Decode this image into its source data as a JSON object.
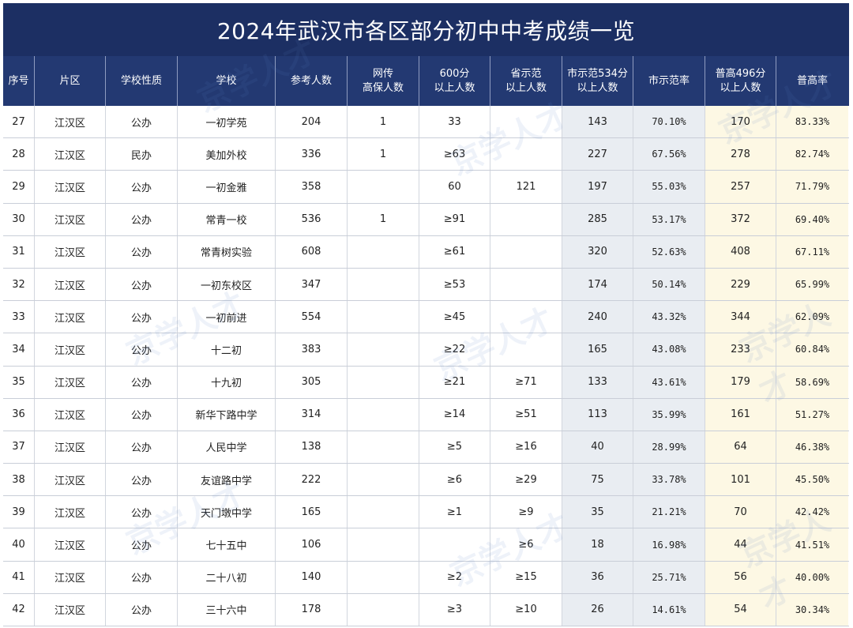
{
  "title": "2024年武汉市各区部分初中中考成绩一览",
  "columns": [
    "序号",
    "片区",
    "学校性质",
    "学校",
    "参考人数",
    "网传\n高保人数",
    "600分\n以上人数",
    "省示范\n以上人数",
    "市示范534分\n以上人数",
    "市示范率",
    "普高496分\n以上人数",
    "普高率"
  ],
  "rows": [
    [
      "27",
      "江汉区",
      "公办",
      "一初学苑",
      "204",
      "1",
      "33",
      "",
      "143",
      "70.10%",
      "170",
      "83.33%"
    ],
    [
      "28",
      "江汉区",
      "民办",
      "美加外校",
      "336",
      "1",
      "≥63",
      "",
      "227",
      "67.56%",
      "278",
      "82.74%"
    ],
    [
      "29",
      "江汉区",
      "公办",
      "一初金雅",
      "358",
      "",
      "60",
      "121",
      "197",
      "55.03%",
      "257",
      "71.79%"
    ],
    [
      "30",
      "江汉区",
      "公办",
      "常青一校",
      "536",
      "1",
      "≥91",
      "",
      "285",
      "53.17%",
      "372",
      "69.40%"
    ],
    [
      "31",
      "江汉区",
      "公办",
      "常青树实验",
      "608",
      "",
      "≥61",
      "",
      "320",
      "52.63%",
      "408",
      "67.11%"
    ],
    [
      "32",
      "江汉区",
      "公办",
      "一初东校区",
      "347",
      "",
      "≥53",
      "",
      "174",
      "50.14%",
      "229",
      "65.99%"
    ],
    [
      "33",
      "江汉区",
      "公办",
      "一初前进",
      "554",
      "",
      "≥45",
      "",
      "240",
      "43.32%",
      "344",
      "62.09%"
    ],
    [
      "34",
      "江汉区",
      "公办",
      "十二初",
      "383",
      "",
      "≥22",
      "",
      "165",
      "43.08%",
      "233",
      "60.84%"
    ],
    [
      "35",
      "江汉区",
      "公办",
      "十九初",
      "305",
      "",
      "≥21",
      "≥71",
      "133",
      "43.61%",
      "179",
      "58.69%"
    ],
    [
      "36",
      "江汉区",
      "公办",
      "新华下路中学",
      "314",
      "",
      "≥14",
      "≥51",
      "113",
      "35.99%",
      "161",
      "51.27%"
    ],
    [
      "37",
      "江汉区",
      "公办",
      "人民中学",
      "138",
      "",
      "≥5",
      "≥16",
      "40",
      "28.99%",
      "64",
      "46.38%"
    ],
    [
      "38",
      "江汉区",
      "公办",
      "友谊路中学",
      "222",
      "",
      "≥6",
      "≥29",
      "75",
      "33.78%",
      "101",
      "45.50%"
    ],
    [
      "39",
      "江汉区",
      "公办",
      "天门墩中学",
      "165",
      "",
      "≥1",
      "≥9",
      "35",
      "21.21%",
      "70",
      "42.42%"
    ],
    [
      "40",
      "江汉区",
      "公办",
      "七十五中",
      "106",
      "",
      "",
      "≥6",
      "18",
      "16.98%",
      "44",
      "41.51%"
    ],
    [
      "41",
      "江汉区",
      "公办",
      "二十八初",
      "140",
      "",
      "≥2",
      "≥15",
      "36",
      "25.71%",
      "56",
      "40.00%"
    ],
    [
      "42",
      "江汉区",
      "公办",
      "三十六中",
      "178",
      "",
      "≥3",
      "≥10",
      "26",
      "14.61%",
      "54",
      "30.34%"
    ]
  ],
  "watermark_text": "京学人才",
  "colors": {
    "title_bg": "#1c2f63",
    "header_bg": "#233972",
    "city_col_bg": "#e9edf2",
    "general_col_bg": "#fdf8e4"
  }
}
